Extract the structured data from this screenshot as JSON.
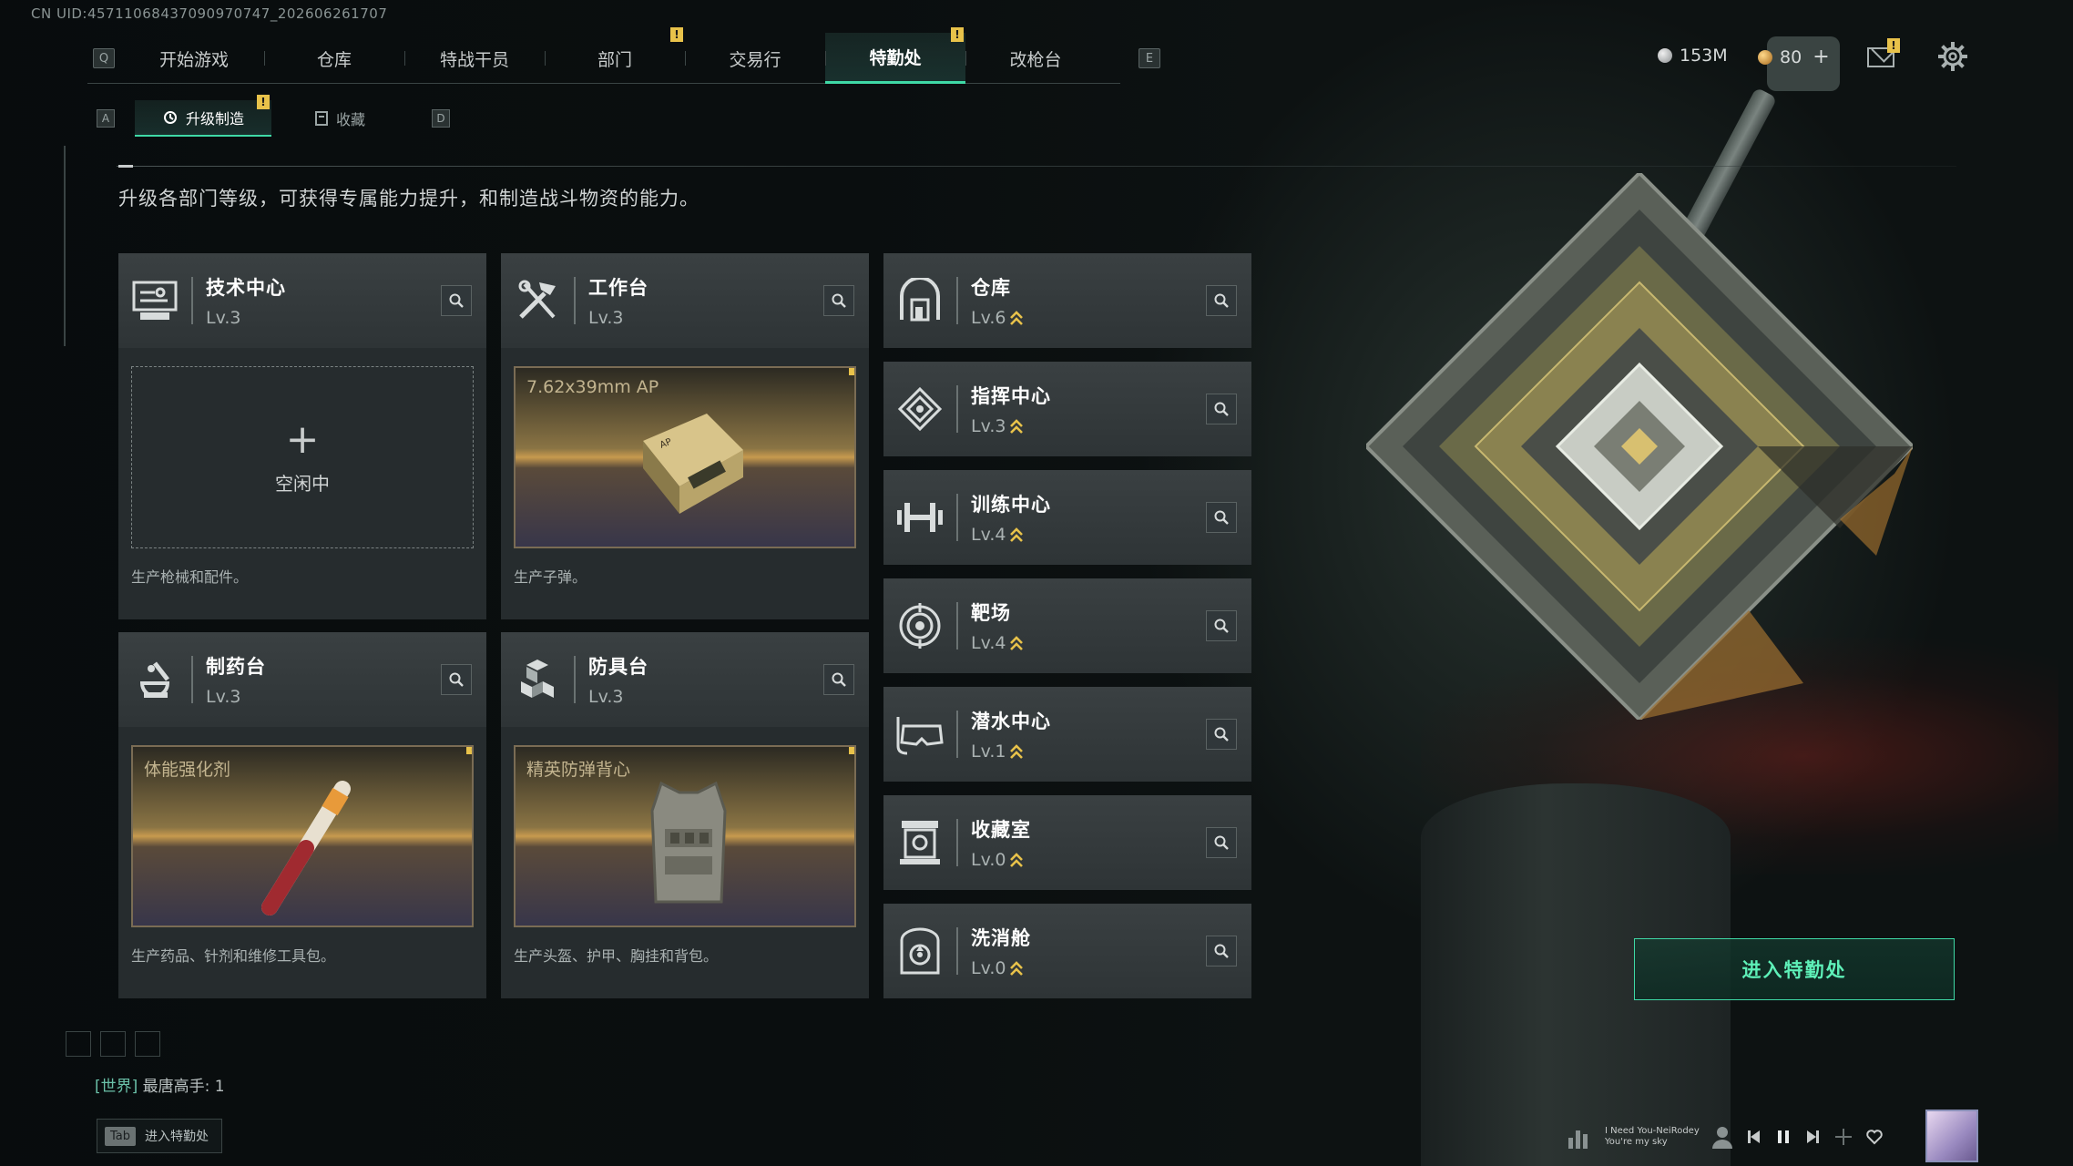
{
  "uid": "CN UID:45711068437090970747_202606261707",
  "nav": {
    "left_key": "Q",
    "right_key": "E",
    "tabs": [
      {
        "label": "开始游戏",
        "active": false,
        "alert": ""
      },
      {
        "label": "仓库",
        "active": false,
        "alert": ""
      },
      {
        "label": "特战干员",
        "active": false,
        "alert": ""
      },
      {
        "label": "部门",
        "active": false,
        "alert": "!"
      },
      {
        "label": "交易行",
        "active": false,
        "alert": ""
      },
      {
        "label": "特勤处",
        "active": true,
        "alert": "!"
      },
      {
        "label": "改枪台",
        "active": false,
        "alert": ""
      }
    ]
  },
  "currency": {
    "silver": "153M",
    "gold": "80",
    "plus": "+"
  },
  "mail_alert": "!",
  "subnav": {
    "left_key": "A",
    "right_key": "D",
    "tabs": [
      {
        "label": "升级制造",
        "active": true,
        "alert": "!"
      },
      {
        "label": "收藏",
        "active": false,
        "alert": ""
      }
    ]
  },
  "description": "升级各部门等级，可获得专属能力提升，和制造战斗物资的能力。",
  "production_cards": [
    {
      "title": "技术中心",
      "level": "Lv.3",
      "icon": "tech-center-icon",
      "slot": "idle",
      "idle_label": "空闲中",
      "item_name": "",
      "alert": "",
      "footer": "生产枪械和配件。"
    },
    {
      "title": "工作台",
      "level": "Lv.3",
      "icon": "workbench-icon",
      "slot": "item",
      "idle_label": "",
      "item_name": "7.62x39mm AP",
      "alert": "!",
      "footer": "生产子弹。"
    },
    {
      "title": "制药台",
      "level": "Lv.3",
      "icon": "pharmacy-icon",
      "slot": "item",
      "idle_label": "",
      "item_name": "体能强化剂",
      "alert": "!",
      "footer": "生产药品、针剂和维修工具包。"
    },
    {
      "title": "防具台",
      "level": "Lv.3",
      "icon": "armor-bench-icon",
      "slot": "item",
      "idle_label": "",
      "item_name": "精英防弹背心",
      "alert": "!",
      "footer": "生产头盔、护甲、胸挂和背包。"
    }
  ],
  "departments": [
    {
      "title": "仓库",
      "level": "Lv.6",
      "icon": "warehouse-icon",
      "upgradable": true
    },
    {
      "title": "指挥中心",
      "level": "Lv.3",
      "icon": "command-center-icon",
      "upgradable": true
    },
    {
      "title": "训练中心",
      "level": "Lv.4",
      "icon": "dumbbell-icon",
      "upgradable": true
    },
    {
      "title": "靶场",
      "level": "Lv.4",
      "icon": "target-icon",
      "upgradable": true
    },
    {
      "title": "潜水中心",
      "level": "Lv.1",
      "icon": "diving-mask-icon",
      "upgradable": true
    },
    {
      "title": "收藏室",
      "level": "Lv.0",
      "icon": "collection-room-icon",
      "upgradable": true
    },
    {
      "title": "洗消舱",
      "level": "Lv.0",
      "icon": "decontamination-icon",
      "upgradable": true
    }
  ],
  "enter_button": "进入特勤处",
  "chat": {
    "channel": "[世界]",
    "message": "最唐高手: 1"
  },
  "tab_hint": {
    "key": "Tab",
    "label": "进入特勤处"
  },
  "media": {
    "line1": "I Need You-NeiRodey",
    "line2": "You're my sky"
  },
  "colors": {
    "accent": "#3fd9a6",
    "alert": "#e8c24a",
    "upgrade_arrow": "#e8c24a"
  }
}
